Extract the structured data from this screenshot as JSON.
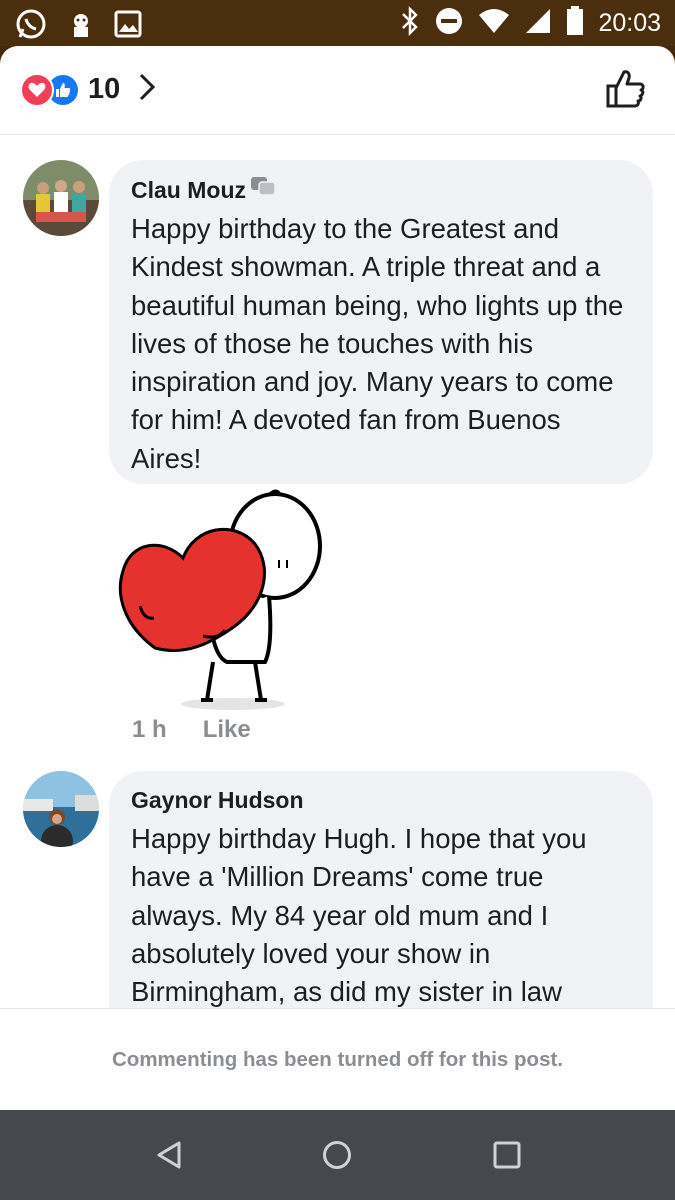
{
  "status_bar": {
    "time": "20:03",
    "left_icons": [
      "whatsapp-icon",
      "sticker-icon",
      "gallery-icon"
    ],
    "right_icons": [
      "bluetooth-icon",
      "do-not-disturb-icon",
      "wifi-icon",
      "signal-icon",
      "battery-icon"
    ]
  },
  "reactions": {
    "count": "10",
    "types": [
      "love-icon",
      "like-icon"
    ]
  },
  "comments": [
    {
      "author": "Clau Mouz",
      "text": "Happy birthday to the Greatest and Kindest showman. A triple threat and a beautiful human being, who lights up the lives of those he touches with his inspiration and joy. Many years to come for him! A devoted fan from Buenos Aires!",
      "time": "1 h",
      "like_label": "Like",
      "sticker": "heart-hug-sticker"
    },
    {
      "author": "Gaynor Hudson",
      "text": "Happy birthday Hugh. I hope that you have a 'Million Dreams' come true always. My 84 year old mum and I absolutely loved your show in Birmingham, as did my sister in law"
    }
  ],
  "footer": {
    "notice": "Commenting has been turned off for this post."
  },
  "colors": {
    "accent": "#1877f2",
    "love": "#f33e58",
    "status_bar": "#4a2e0e",
    "nav_bar": "#45494d"
  }
}
